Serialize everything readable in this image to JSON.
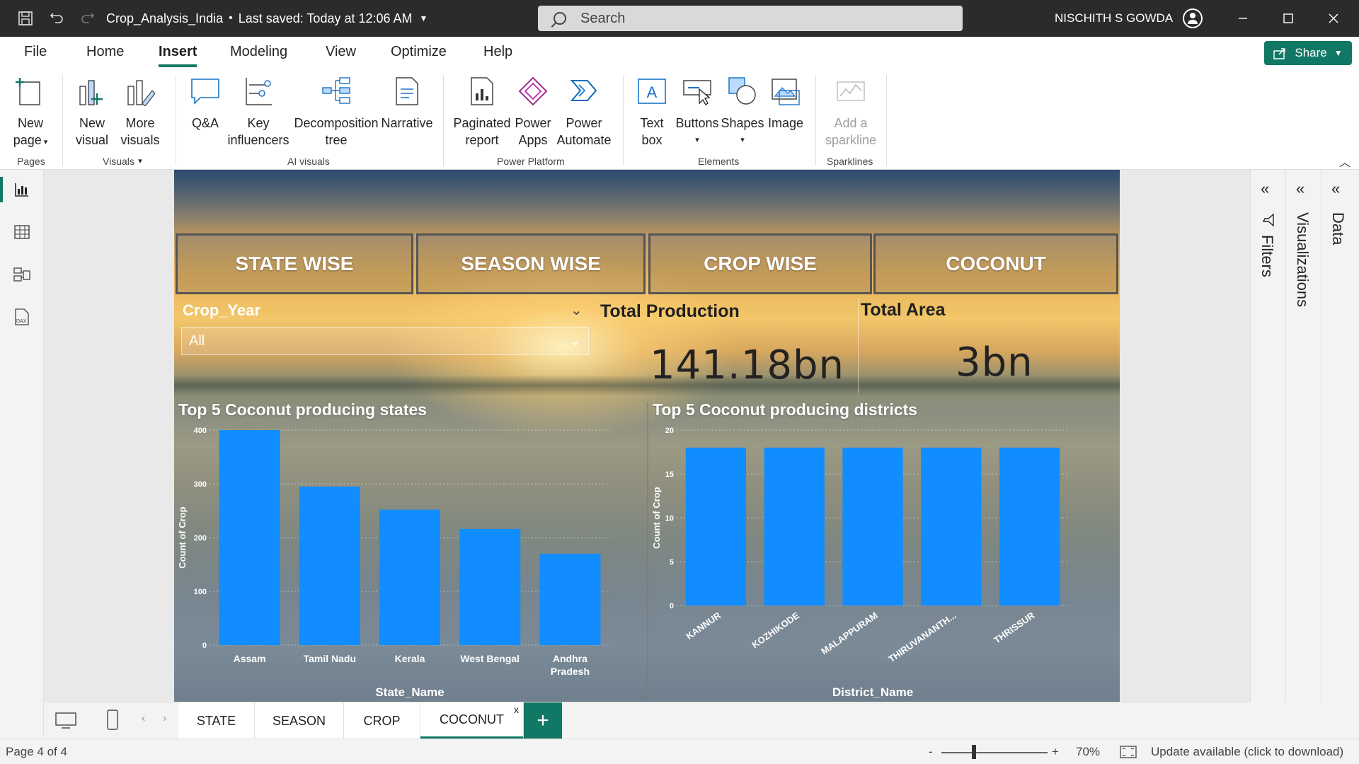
{
  "titlebar": {
    "file_title": "Crop_Analysis_India",
    "saved_status": "Last saved: Today at 12:06 AM",
    "search_placeholder": "Search",
    "user_name": "NISCHITH S GOWDA"
  },
  "menu": {
    "items": [
      "File",
      "Home",
      "Insert",
      "Modeling",
      "View",
      "Optimize",
      "Help"
    ],
    "active": "Insert",
    "share_label": "Share"
  },
  "ribbon": {
    "buttons": {
      "new_page": [
        "New",
        "page"
      ],
      "new_visual": [
        "New",
        "visual"
      ],
      "more_visuals": [
        "More",
        "visuals"
      ],
      "qa": [
        "Q&A"
      ],
      "key_influencers": [
        "Key",
        "influencers"
      ],
      "decomposition_tree": [
        "Decomposition",
        "tree"
      ],
      "narrative": [
        "Narrative"
      ],
      "paginated_report": [
        "Paginated",
        "report"
      ],
      "power_apps": [
        "Power",
        "Apps"
      ],
      "power_automate": [
        "Power",
        "Automate"
      ],
      "text_box": [
        "Text",
        "box"
      ],
      "buttons": [
        "Buttons"
      ],
      "shapes": [
        "Shapes"
      ],
      "image": [
        "Image"
      ],
      "add_sparkline": [
        "Add a",
        "sparkline"
      ]
    },
    "groups": {
      "pages": "Pages",
      "visuals": "Visuals",
      "ai_visuals": "AI visuals",
      "power_platform": "Power Platform",
      "elements": "Elements",
      "sparklines": "Sparklines"
    }
  },
  "report": {
    "nav_buttons": [
      "STATE WISE",
      "SEASON WISE",
      "CROP WISE",
      "COCONUT"
    ],
    "slicer": {
      "title": "Crop_Year",
      "value": "All"
    },
    "cards": [
      {
        "title": "Total Production",
        "value": "141.18bn"
      },
      {
        "title": "Total Area",
        "value": "3bn"
      }
    ]
  },
  "chart_data": [
    {
      "type": "bar",
      "title": "Top 5 Coconut producing states",
      "xlabel": "State_Name",
      "ylabel": "Count of Crop",
      "categories": [
        "Assam",
        "Tamil Nadu",
        "Kerala",
        "West Bengal",
        "Andhra Pradesh"
      ],
      "values": [
        400,
        295,
        252,
        216,
        170
      ],
      "ylim": [
        0,
        400
      ],
      "yticks": [
        0,
        100,
        200,
        300,
        400
      ],
      "color": "#118dff",
      "grid": true
    },
    {
      "type": "bar",
      "title": "Top 5 Coconut producing districts",
      "xlabel": "District_Name",
      "ylabel": "Count of Crop",
      "categories": [
        "KANNUR",
        "KOZHIKODE",
        "MALAPPURAM",
        "THIRUVANANTH...",
        "THRISSUR"
      ],
      "values": [
        18,
        18,
        18,
        18,
        18
      ],
      "ylim": [
        0,
        20
      ],
      "yticks": [
        0,
        5,
        10,
        15,
        20
      ],
      "color": "#118dff",
      "grid": true
    }
  ],
  "panes": [
    "Filters",
    "Visualizations",
    "Data"
  ],
  "page_tabs": {
    "tabs": [
      "STATE",
      "SEASON",
      "CROP",
      "COCONUT"
    ],
    "active": "COCONUT",
    "close_glyph": "x",
    "add_glyph": "+"
  },
  "statusbar": {
    "page_info": "Page 4 of 4",
    "zoom_minus": "-",
    "zoom_plus": "+",
    "zoom": "70%",
    "update": "Update available (click to download)"
  },
  "colors": {
    "accent": "#117865",
    "bar": "#118dff",
    "titlebar": "#2b2b2b"
  }
}
